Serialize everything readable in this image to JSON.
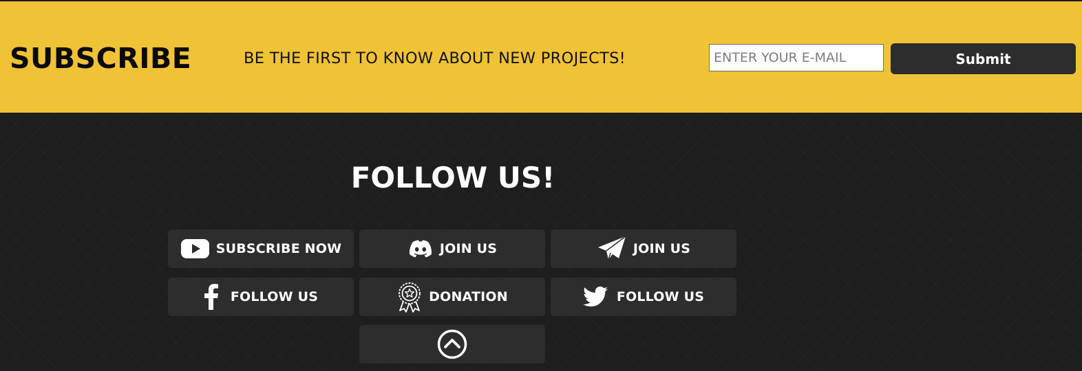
{
  "subscribe": {
    "title": "SUBSCRIBE",
    "tagline": "BE THE FIRST TO KNOW ABOUT NEW PROJECTS!",
    "email_placeholder": "ENTER YOUR E-MAIL",
    "email_value": "",
    "submit_label": "Submit",
    "colors": {
      "bar_background": "#f0c235",
      "submit_background": "#2d2d2d"
    }
  },
  "follow": {
    "title": "FOLLOW US!",
    "buttons": [
      {
        "label": "SUBSCRIBE NOW",
        "icon": "youtube-icon"
      },
      {
        "label": "JOIN US",
        "icon": "discord-icon"
      },
      {
        "label": "JOIN US",
        "icon": "telegram-icon"
      },
      {
        "label": "FOLLOW US",
        "icon": "facebook-icon"
      },
      {
        "label": "DONATION",
        "icon": "donation-badge-icon"
      },
      {
        "label": "FOLLOW US",
        "icon": "twitter-icon"
      }
    ],
    "back_to_top_icon": "chevron-up-circle-icon",
    "colors": {
      "footer_background": "#1e1e1e",
      "button_background": "#2d2d2d",
      "text": "#ffffff"
    }
  }
}
